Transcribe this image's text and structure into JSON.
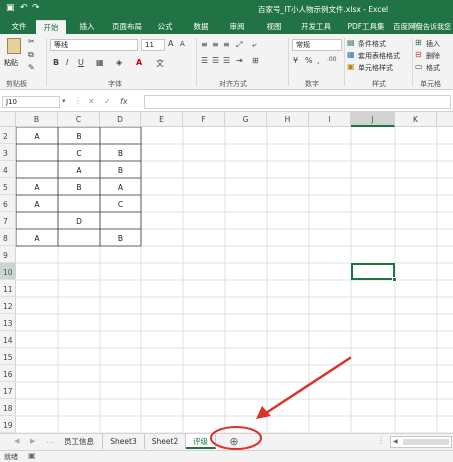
{
  "window_title": "百家号_IT小人物示例文件.xlsx - Excel",
  "ribbon_tabs": [
    {
      "label": "文件",
      "active": false
    },
    {
      "label": "开始",
      "active": true
    },
    {
      "label": "插入",
      "active": false
    },
    {
      "label": "页面布局",
      "active": false
    },
    {
      "label": "公式",
      "active": false
    },
    {
      "label": "数据",
      "active": false
    },
    {
      "label": "审阅",
      "active": false
    },
    {
      "label": "视图",
      "active": false
    },
    {
      "label": "开发工具",
      "active": false
    },
    {
      "label": "PDF工具集",
      "active": false
    },
    {
      "label": "百度网盘",
      "active": false
    }
  ],
  "tell_me": "告诉我您",
  "ribbon": {
    "paste_label": "粘贴",
    "clipboard_label": "剪贴板",
    "font_name": "等线",
    "font_size": "11",
    "font_label": "字体",
    "alignment_label": "对齐方式",
    "number_format": "常规",
    "number_label": "数字",
    "conditional_format": "条件格式",
    "format_as_table": "套用表格格式",
    "cell_styles": "单元格样式",
    "styles_label": "样式",
    "insert": "插入",
    "delete": "删除",
    "format": "格式",
    "cells_label": "单元格"
  },
  "name_box": "J10",
  "formula_fx": "fx",
  "columns": [
    "B",
    "C",
    "D",
    "E",
    "F",
    "G",
    "H",
    "I",
    "J",
    "K"
  ],
  "selected_column": "J",
  "rows": [
    "2",
    "3",
    "4",
    "5",
    "6",
    "7",
    "8",
    "9",
    "10",
    "11",
    "12",
    "13",
    "14",
    "15",
    "16",
    "17",
    "18",
    "19"
  ],
  "selected_row": "10",
  "cells": [
    {
      "row": "2",
      "col": "B",
      "value": "A"
    },
    {
      "row": "2",
      "col": "C",
      "value": "B"
    },
    {
      "row": "3",
      "col": "C",
      "value": "C"
    },
    {
      "row": "3",
      "col": "D",
      "value": "B"
    },
    {
      "row": "4",
      "col": "C",
      "value": "A"
    },
    {
      "row": "4",
      "col": "D",
      "value": "B"
    },
    {
      "row": "5",
      "col": "B",
      "value": "A"
    },
    {
      "row": "5",
      "col": "C",
      "value": "B"
    },
    {
      "row": "5",
      "col": "D",
      "value": "A"
    },
    {
      "row": "6",
      "col": "B",
      "value": "A"
    },
    {
      "row": "6",
      "col": "D",
      "value": "C"
    },
    {
      "row": "7",
      "col": "C",
      "value": "D"
    },
    {
      "row": "8",
      "col": "B",
      "value": "A"
    },
    {
      "row": "8",
      "col": "D",
      "value": "B"
    }
  ],
  "sheet_tabs": [
    {
      "label": "员工信息",
      "active": false
    },
    {
      "label": "Sheet3",
      "active": false
    },
    {
      "label": "Sheet2",
      "active": false
    },
    {
      "label": "评级",
      "active": true
    }
  ],
  "new_sheet_symbol": "⊕",
  "status_text": "就绪",
  "colors": {
    "excel_green": "#217346",
    "annotation_red": "#d9332b"
  }
}
